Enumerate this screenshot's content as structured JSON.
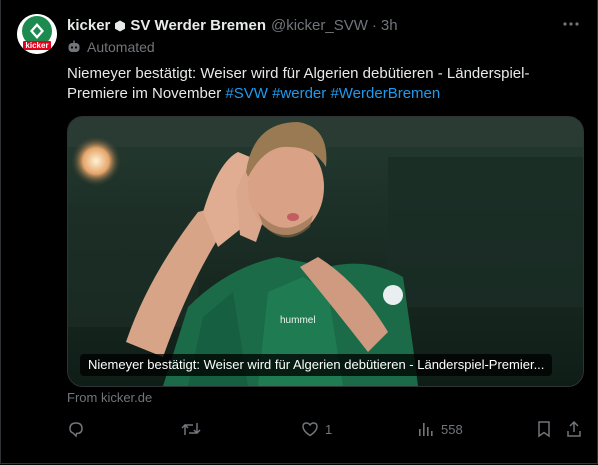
{
  "author": {
    "name": "kicker",
    "affiliation": "SV Werder Bremen",
    "handle": "@kicker_SVW",
    "separator": "·",
    "time": "3h",
    "label": "Automated",
    "avatar_text": "kicker"
  },
  "post": {
    "text": "Niemeyer bestätigt: Weiser wird für Algerien debütieren - Länderspiel-Premiere im November",
    "hashtags": [
      "#SVW",
      "#werder",
      "#WerderBremen"
    ]
  },
  "card": {
    "title": "Niemeyer bestätigt: Weiser wird für Algerien debütieren - Länderspiel-Premier...",
    "source": "From kicker.de"
  },
  "actions": {
    "reply_count": "",
    "repost_count": "",
    "like_count": "1",
    "views_count": "558"
  },
  "colors": {
    "background": "#000000",
    "accent": "#1d9bf0",
    "muted": "#71767b",
    "werder_green": "#1d8b4f"
  }
}
